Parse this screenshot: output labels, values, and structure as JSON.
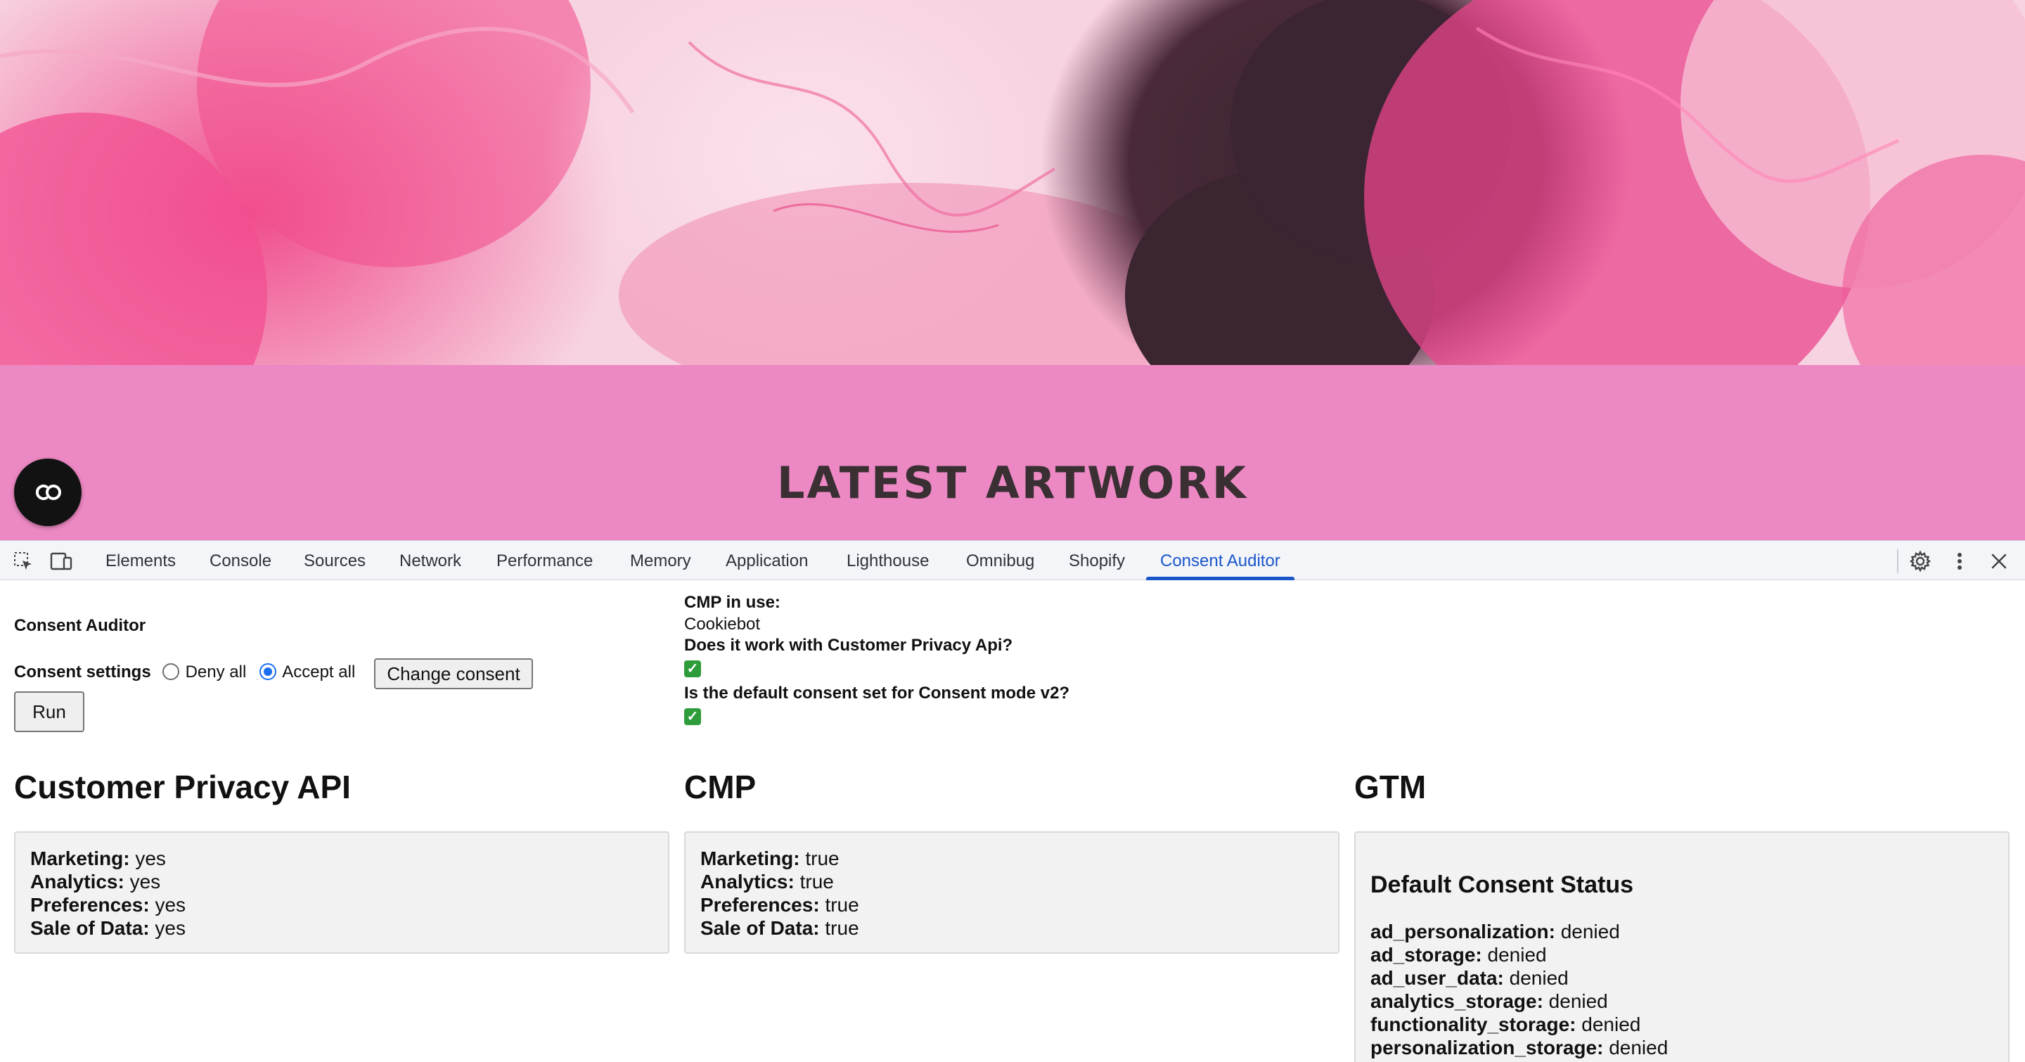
{
  "site": {
    "section_title": "LATEST ARTWORK",
    "badge_icon": "cc-icon",
    "colors": {
      "hero_pink": "#f14c8f",
      "band_pink": "#ec88c3",
      "title": "#3a2f33"
    }
  },
  "devtools": {
    "tabs": [
      {
        "label": "Elements"
      },
      {
        "label": "Console"
      },
      {
        "label": "Sources"
      },
      {
        "label": "Network"
      },
      {
        "label": "Performance"
      },
      {
        "label": "Memory"
      },
      {
        "label": "Application"
      },
      {
        "label": "Lighthouse"
      },
      {
        "label": "Omnibug"
      },
      {
        "label": "Shopify"
      },
      {
        "label": "Consent Auditor"
      }
    ],
    "active_tab": "Consent Auditor",
    "icons": [
      "inspect-icon",
      "device-toolbar-icon",
      "settings-gear-icon",
      "more-vert-icon",
      "close-icon"
    ],
    "accent_color": "#1a56c9"
  },
  "auditor": {
    "title": "Consent Auditor",
    "settings_label": "Consent settings",
    "options": [
      {
        "label": "Deny all",
        "selected": false
      },
      {
        "label": "Accept all",
        "selected": true
      }
    ],
    "change_consent_label": "Change consent",
    "run_label": "Run",
    "cmp_in_use_label": "CMP in use:",
    "cmp_in_use_value": "Cookiebot",
    "q_customer_privacy": "Does it work with Customer Privacy Api?",
    "q_default_consent": "Is the default consent set for Consent mode v2?",
    "answer_icon": "check-mark-icon"
  },
  "sections": {
    "customer_privacy": {
      "heading": "Customer Privacy API",
      "rows": [
        {
          "key": "Marketing:",
          "value": "yes"
        },
        {
          "key": "Analytics:",
          "value": "yes"
        },
        {
          "key": "Preferences:",
          "value": "yes"
        },
        {
          "key": "Sale of Data:",
          "value": "yes"
        }
      ]
    },
    "cmp": {
      "heading": "CMP",
      "rows": [
        {
          "key": "Marketing:",
          "value": "true"
        },
        {
          "key": "Analytics:",
          "value": "true"
        },
        {
          "key": "Preferences:",
          "value": "true"
        },
        {
          "key": "Sale of Data:",
          "value": "true"
        }
      ]
    },
    "gtm": {
      "heading": "GTM",
      "subheading": "Default Consent Status",
      "rows": [
        {
          "key": "ad_personalization:",
          "value": "denied"
        },
        {
          "key": "ad_storage:",
          "value": "denied"
        },
        {
          "key": "ad_user_data:",
          "value": "denied"
        },
        {
          "key": "analytics_storage:",
          "value": "denied"
        },
        {
          "key": "functionality_storage:",
          "value": "denied"
        },
        {
          "key": "personalization_storage:",
          "value": "denied"
        }
      ]
    }
  }
}
